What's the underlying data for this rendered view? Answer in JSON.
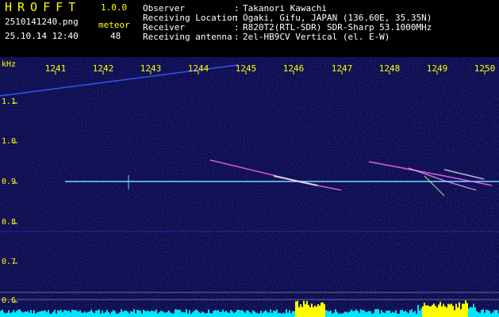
{
  "app": {
    "title": "HROFFT",
    "version": "1.0.0"
  },
  "file": {
    "name": "2510141240.png",
    "datetime": "25.10.14 12:40"
  },
  "meteor": {
    "label": "meteor",
    "count": "48"
  },
  "info": [
    {
      "label": "Observer",
      "value": "Takanori Kawachi"
    },
    {
      "label": "Receiving Location",
      "value": "Ogaki, Gifu, JAPAN (136.60E, 35.35N)"
    },
    {
      "label": "Receiver",
      "value": "R820T2(RTL-SDR) SDR-Sharp 53.1000MHz"
    },
    {
      "label": "Receiving antenna",
      "value": "2el-HB9CV Vertical (el. E-W)"
    }
  ],
  "spectrogram": {
    "y_unit": "kHz",
    "x_ticks": [
      "1241",
      "1242",
      "1243",
      "1244",
      "1245",
      "1246",
      "1247",
      "1248",
      "1249",
      "1250"
    ],
    "y_ticks": [
      "1.1",
      "1.0",
      "0.9",
      "0.8",
      "0.7",
      "0.6"
    ]
  },
  "colors": {
    "label_text": "#ffff00",
    "header_text": "#ffffff",
    "background": "#000000",
    "noise_floor": "#0a0a5a",
    "carrier": "#7ad7ff",
    "meteor_echo": "#ff66ff",
    "level_bar": "#00e5ff",
    "level_bar_peak": "#ffff00"
  }
}
